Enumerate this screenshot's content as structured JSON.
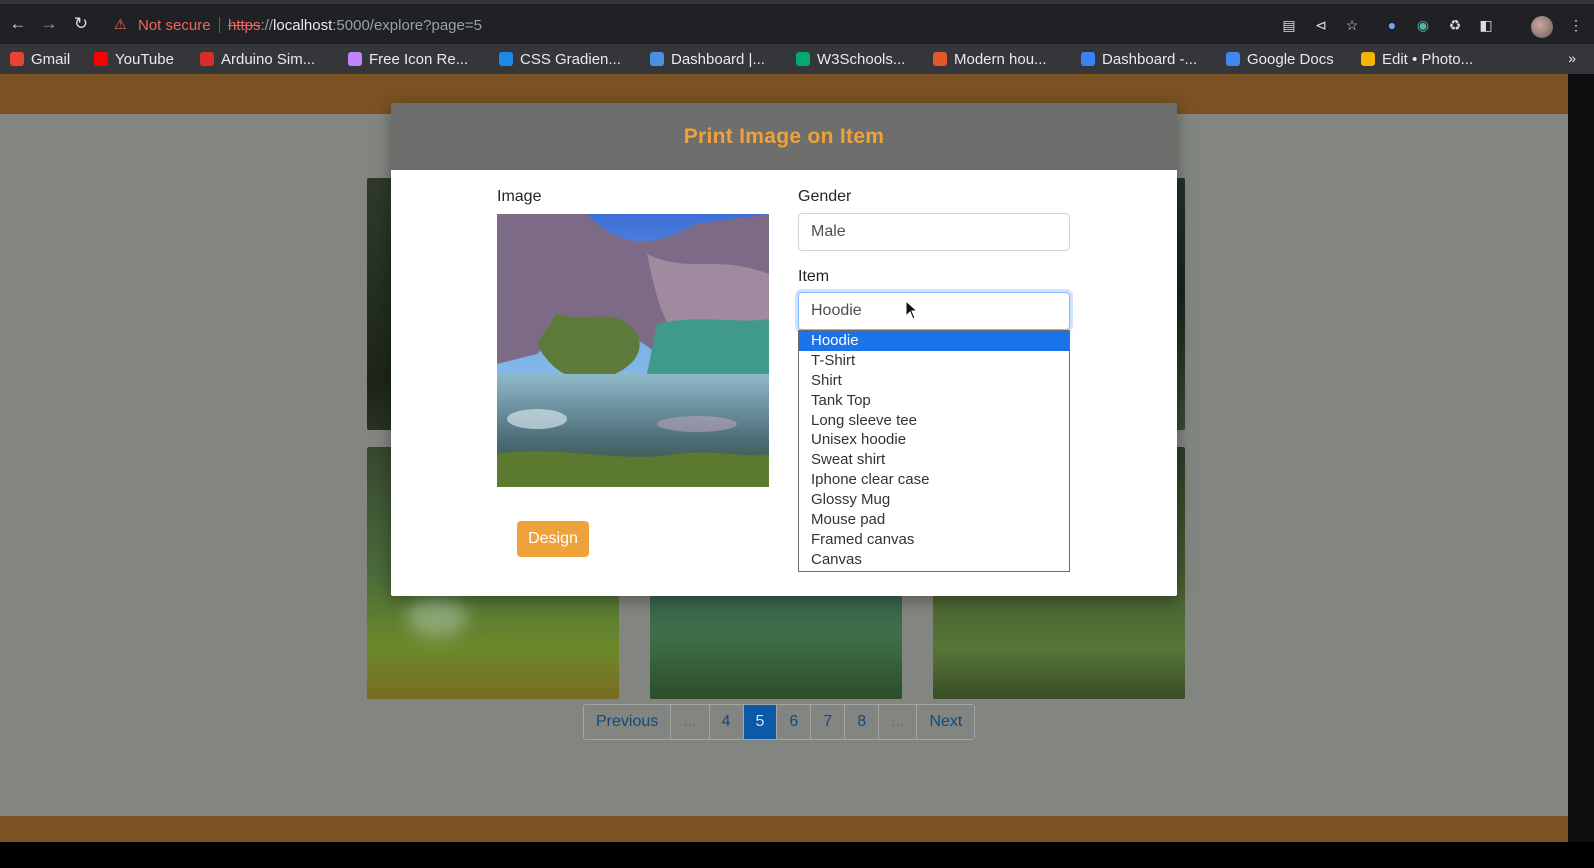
{
  "browser": {
    "warning": "Not secure",
    "url_scheme": "https",
    "url_host": "localhost",
    "url_rest": ":5000/explore?page=5",
    "bookmarks": [
      {
        "label": "Gmail",
        "color": "#ea4335"
      },
      {
        "label": "YouTube",
        "color": "#ff0000"
      },
      {
        "label": "Arduino Sim...",
        "color": "#d92b2b"
      },
      {
        "label": "Free Icon Re...",
        "color": "#c084fc"
      },
      {
        "label": "CSS Gradien...",
        "color": "#1e88e5"
      },
      {
        "label": "Dashboard |...",
        "color": "#4a90e2"
      },
      {
        "label": "W3Schools...",
        "color": "#04aa6d"
      },
      {
        "label": "Modern hou...",
        "color": "#e4572e"
      },
      {
        "label": "Dashboard -...",
        "color": "#3b82f6"
      },
      {
        "label": "Google Docs",
        "color": "#4285f4"
      },
      {
        "label": "Edit • Photo...",
        "color": "#f4b400"
      }
    ]
  },
  "modal": {
    "title": "Print Image on Item",
    "image_label": "Image",
    "design_button": "Design",
    "gender_label": "Gender",
    "gender_value": "Male",
    "item_label": "Item",
    "item_value": "Hoodie",
    "item_options": [
      "Hoodie",
      "T-Shirt",
      "Shirt",
      "Tank Top",
      "Long sleeve tee",
      "Unisex hoodie",
      "Sweat shirt",
      "Iphone clear case",
      "Glossy Mug",
      "Mouse pad",
      "Framed canvas",
      "Canvas"
    ],
    "selected_option": "Hoodie"
  },
  "pagination": [
    "Previous",
    "...",
    "4",
    "5",
    "6",
    "7",
    "8",
    "...",
    "Next"
  ],
  "current_page": "5",
  "colors": {
    "accent": "#f0a23a",
    "header_bar": "#7a5223",
    "active_page": "#0b5aa8"
  }
}
